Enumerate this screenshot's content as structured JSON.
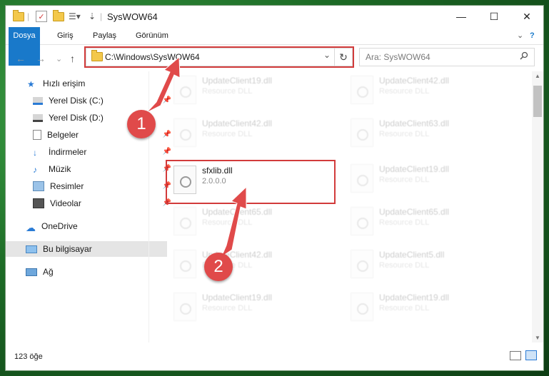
{
  "window": {
    "title": "SysWOW64",
    "minimize": "—",
    "maximize": "☐",
    "close": "✕"
  },
  "ribbon": {
    "tabs": [
      "Dosya",
      "Giriş",
      "Paylaş",
      "Görünüm"
    ],
    "expand": "⌄",
    "help": "?"
  },
  "address": {
    "path": "C:\\Windows\\SysWOW64",
    "refresh": "↻",
    "dropdown": "⌄"
  },
  "search": {
    "placeholder": "Ara: SysWOW64",
    "icon": "search-icon"
  },
  "nav_buttons": {
    "back": "←",
    "forward": "→",
    "recent": "⌄",
    "up": "↑"
  },
  "sidebar": {
    "items": [
      {
        "label": "Hızlı erişim",
        "icon": "star-icon",
        "pinned": false
      },
      {
        "label": "Yerel Disk (C:)",
        "icon": "drive-icon",
        "pinned": true
      },
      {
        "label": "Yerel Disk (D:)",
        "icon": "drive-icon",
        "pinned": false
      },
      {
        "label": "Belgeler",
        "icon": "documents-icon",
        "pinned": true
      },
      {
        "label": "İndirmeler",
        "icon": "download-icon",
        "pinned": true
      },
      {
        "label": "Müzik",
        "icon": "music-icon",
        "pinned": true
      },
      {
        "label": "Resimler",
        "icon": "pictures-icon",
        "pinned": true
      },
      {
        "label": "Videolar",
        "icon": "video-icon",
        "pinned": true
      },
      {
        "label": "OneDrive",
        "icon": "cloud-icon",
        "pinned": false
      },
      {
        "label": "Bu bilgisayar",
        "icon": "computer-icon",
        "pinned": false
      },
      {
        "label": "Ağ",
        "icon": "network-icon",
        "pinned": false
      }
    ],
    "pin_glyph": "📌"
  },
  "files": {
    "left": [
      {
        "name": "UpdateClient19.dll",
        "sub": "Resource DLL"
      },
      {
        "name": "UpdateClient42.dll",
        "sub": "Resource DLL"
      },
      {
        "name": "sfxlib.dll",
        "sub": "2.0.0.0"
      },
      {
        "name": "UpdateClient65.dll",
        "sub": "Resource DLL"
      },
      {
        "name": "UpdateClient42.dll",
        "sub": "Resource DLL"
      },
      {
        "name": "UpdateClient19.dll",
        "sub": "Resource DLL"
      }
    ],
    "right": [
      {
        "name": "UpdateClient42.dll",
        "sub": "Resource DLL"
      },
      {
        "name": "UpdateClient63.dll",
        "sub": "Resource DLL"
      },
      {
        "name": "UpdateClient19.dll",
        "sub": "Resource DLL"
      },
      {
        "name": "UpdateClient65.dll",
        "sub": "Resource DLL"
      },
      {
        "name": "UpdateClient5.dll",
        "sub": "Resource DLL"
      },
      {
        "name": "UpdateClient19.dll",
        "sub": "Resource DLL"
      }
    ]
  },
  "status": {
    "count": "123 öğe"
  },
  "callouts": [
    "1",
    "2"
  ],
  "colors": {
    "accent": "#1979ca",
    "highlight": "#d23b3b",
    "badge": "#e04a4a"
  }
}
